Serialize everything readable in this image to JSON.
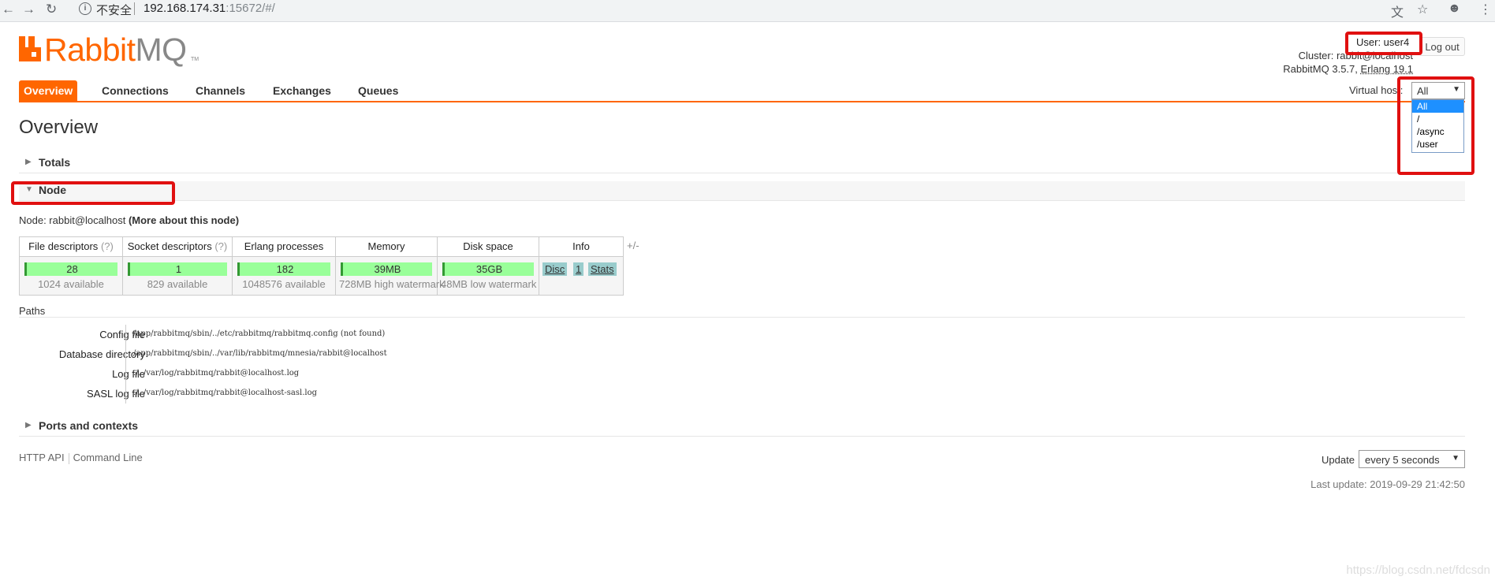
{
  "browser": {
    "insecure_label": "不安全",
    "url_host": "192.168.174.31",
    "url_rest": ":15672/#/"
  },
  "logo": {
    "part1": "Rabbit",
    "part2": "MQ",
    "tm": "TM"
  },
  "header": {
    "user_label": "User: user4",
    "logout_label": "Log out",
    "cluster_label": "Cluster: ",
    "cluster_value": "rabbit@localhost",
    "version_prefix": "RabbitMQ 3.5.7, ",
    "erlang_label": "Erlang 19.1"
  },
  "tabs": [
    "Overview",
    "Connections",
    "Channels",
    "Exchanges",
    "Queues"
  ],
  "vhost": {
    "label": "Virtual host:",
    "selected": "All",
    "options": [
      "All",
      "/",
      "/async",
      "/user"
    ]
  },
  "page_title": "Overview",
  "sections": {
    "totals": "Totals",
    "node": "Node",
    "ports": "Ports and contexts"
  },
  "node": {
    "label": "Node: rabbit@localhost",
    "more": "(More about this node)"
  },
  "stats": {
    "headers": [
      "File descriptors",
      "Socket descriptors",
      "Erlang processes",
      "Memory",
      "Disk space",
      "Info"
    ],
    "help": "(?)",
    "values": [
      "28",
      "1",
      "182",
      "39MB",
      "35GB"
    ],
    "subs": [
      "1024 available",
      "829 available",
      "1048576 available",
      "728MB high watermark",
      "48MB low watermark"
    ],
    "info_badges": [
      "Disc",
      "1",
      "Stats"
    ],
    "plus_minus": "+/-"
  },
  "paths": {
    "title": "Paths",
    "rows": [
      {
        "key": "Config file",
        "value": "/app/rabbitmq/sbin/../etc/rabbitmq/rabbitmq.config (not found)"
      },
      {
        "key": "Database directory",
        "value": "/app/rabbitmq/sbin/../var/lib/rabbitmq/mnesia/rabbit@localhost"
      },
      {
        "key": "Log file",
        "value": "./../var/log/rabbitmq/rabbit@localhost.log"
      },
      {
        "key": "SASL log file",
        "value": "./../var/log/rabbitmq/rabbit@localhost-sasl.log"
      }
    ]
  },
  "footer": {
    "http_api": "HTTP API",
    "command_line": "Command Line",
    "update_label": "Update",
    "update_value": "every 5 seconds",
    "last_update": "Last update: 2019-09-29 21:42:50"
  },
  "watermark": "https://blog.csdn.net/fdcsdn",
  "colors": {
    "brand": "#ff6600",
    "bar": "#99ff99",
    "annotation": "#e01010"
  },
  "icons": [
    "back-icon",
    "forward-icon",
    "reload-icon",
    "info-icon",
    "translate-icon",
    "star-icon",
    "account-icon",
    "menu-icon"
  ]
}
